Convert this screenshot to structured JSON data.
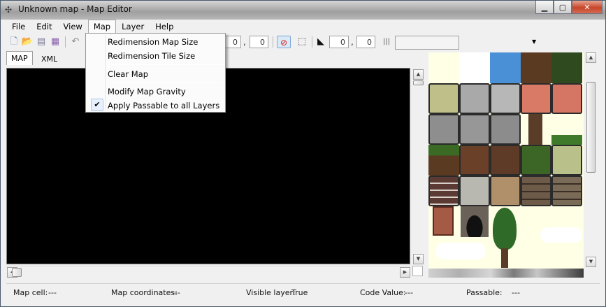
{
  "window": {
    "title": "Unknown map - Map Editor"
  },
  "menubar": {
    "items": [
      "File",
      "Edit",
      "View",
      "Map",
      "Layer",
      "Help"
    ],
    "open_menu": "Map"
  },
  "toolbar": {
    "offset_x": "0",
    "offset_y": "0",
    "selection_x": "0",
    "selection_y": "0",
    "comma": ","
  },
  "tabs": [
    "MAP",
    "XML"
  ],
  "map_menu": {
    "items": [
      {
        "label": "Redimension Map Size",
        "checked": false
      },
      {
        "label": "Redimension Tile Size",
        "checked": false
      },
      {
        "label": "Clear Map",
        "checked": false
      },
      {
        "label": "Modify Map Gravity",
        "checked": false
      },
      {
        "label": "Apply Passable to all Layers",
        "checked": true
      }
    ]
  },
  "status": {
    "map_cell_label": "Map cell:",
    "map_cell_value": "---",
    "map_coords_label": "Map coordinates:",
    "map_coords_value": "---",
    "visible_layer_label": "Visible layer:",
    "visible_layer_value": "True",
    "code_value_label": "Code Value:",
    "code_value_value": "---",
    "passable_label": "Passable:",
    "passable_value": "---"
  },
  "palette_colors": {
    "sky": "#4a90d6",
    "dirt": "#5b3a22",
    "grass": "#2f5a1f",
    "stone": "#a9a9a9",
    "brick": "#d97a66",
    "wood": "#8a6a4a",
    "cream": "#ffffe6"
  }
}
